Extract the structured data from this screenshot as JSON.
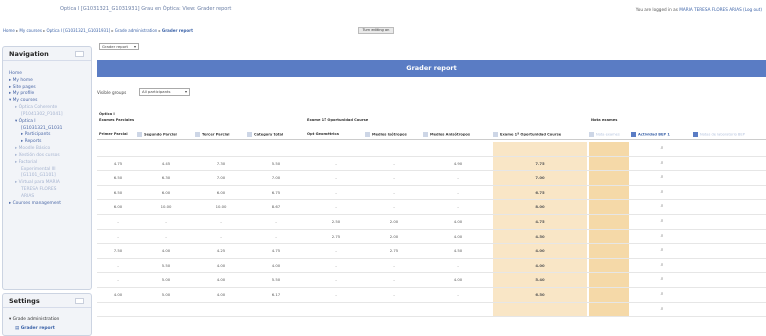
{
  "header": {
    "title": "Optica I [G1031321_G1031931] Grau en Òptica: View: Grader report",
    "login_prefix": "You are logged in as",
    "login_user": "MARIA TERESA FLORES ARIAS (Log out)"
  },
  "breadcrumb": {
    "home": "Home",
    "my_courses": "My courses",
    "course": "Optica I [G1031321_G1031931]",
    "grades": "Grade administration",
    "current": "Grader report"
  },
  "turn_editing_label": "Turn editing on",
  "report_select": {
    "value": "Grader report"
  },
  "navigation": {
    "title": "Navigation",
    "items": [
      "Home",
      "My home",
      "Site pages",
      "My profile",
      "My courses",
      "Óptica Coherente",
      "[P1041302_P1041]",
      "Óptica I",
      "[G1031321_G1031",
      "Participants",
      "Reports",
      "Moodle Básico",
      "Xestión dos cursos",
      "Factorial",
      "Experimental III",
      "[G1101_G1101]",
      "Virtual para MARIA",
      "TERESA FLORES",
      "ARIAS",
      "Courses management"
    ]
  },
  "settings": {
    "title": "Settings",
    "items": [
      "Grade administration",
      "Grader report"
    ]
  },
  "banner_title": "Grader report",
  "visible_groups": {
    "label": "Visible groups",
    "value": "All participants"
  },
  "grid": {
    "course_label": "Óptica I",
    "categories": [
      "Exames Parciales",
      "Exame 1ª Oportunidad Course",
      "Nota exames"
    ],
    "columns": [
      "Primer Parcial",
      "Segundo Parcial",
      "Tercer Parcial",
      "Category total",
      "Opt Geométrica",
      "Medios Isótropos",
      "Medios Anisótropos",
      "Exame 1ª Oportunidad Course",
      "Nota exames",
      "Actividad BEP 1",
      "Notas de laboratorio BEP"
    ],
    "rows": [
      [
        "",
        "",
        "",
        "",
        "",
        "",
        "",
        "",
        "",
        ""
      ],
      [
        "4.75",
        "4.45",
        "7.30",
        "5.50",
        "-",
        "-",
        "4.90",
        "7.75",
        "",
        ""
      ],
      [
        "6.50",
        "6.30",
        "7.00",
        "7.00",
        "-",
        "-",
        "-",
        "7.00",
        "",
        ""
      ],
      [
        "6.50",
        "6.00",
        "6.00",
        "6.75",
        "-",
        "-",
        "-",
        "6.75",
        "",
        ""
      ],
      [
        "6.00",
        "10.00",
        "10.00",
        "8.67",
        "-",
        "-",
        "-",
        "8.00",
        "",
        ""
      ],
      [
        "-",
        "-",
        "-",
        "-",
        "2.50",
        "2.00",
        "4.00",
        "4.75",
        "",
        ""
      ],
      [
        "-",
        "-",
        "-",
        "-",
        "2.75",
        "2.00",
        "4.00",
        "4.50",
        "",
        ""
      ],
      [
        "7.50",
        "4.00",
        "4.25",
        "4.75",
        "-",
        "2.75",
        "4.50",
        "4.00",
        "",
        ""
      ],
      [
        "-",
        "5.50",
        "4.00",
        "4.00",
        "-",
        "-",
        "-",
        "4.00",
        "",
        ""
      ],
      [
        "-",
        "5.00",
        "4.00",
        "5.50",
        "-",
        "-",
        "4.00",
        "5.40",
        "",
        ""
      ],
      [
        "4.00",
        "5.00",
        "4.00",
        "6.17",
        "-",
        "-",
        "-",
        "6.50",
        "",
        ""
      ],
      [
        "",
        "",
        "",
        "",
        "",
        "",
        "",
        "",
        "",
        ""
      ]
    ]
  },
  "colors": {
    "banner": "#5a7cc4",
    "highlight": "#f9e6c6",
    "link": "#3c63a8",
    "block_bg": "#f2f4f8"
  },
  "icons": {
    "search": "magnifier-icon",
    "block_toggle": "block-toggle-icon",
    "sort": "sort-icon"
  }
}
